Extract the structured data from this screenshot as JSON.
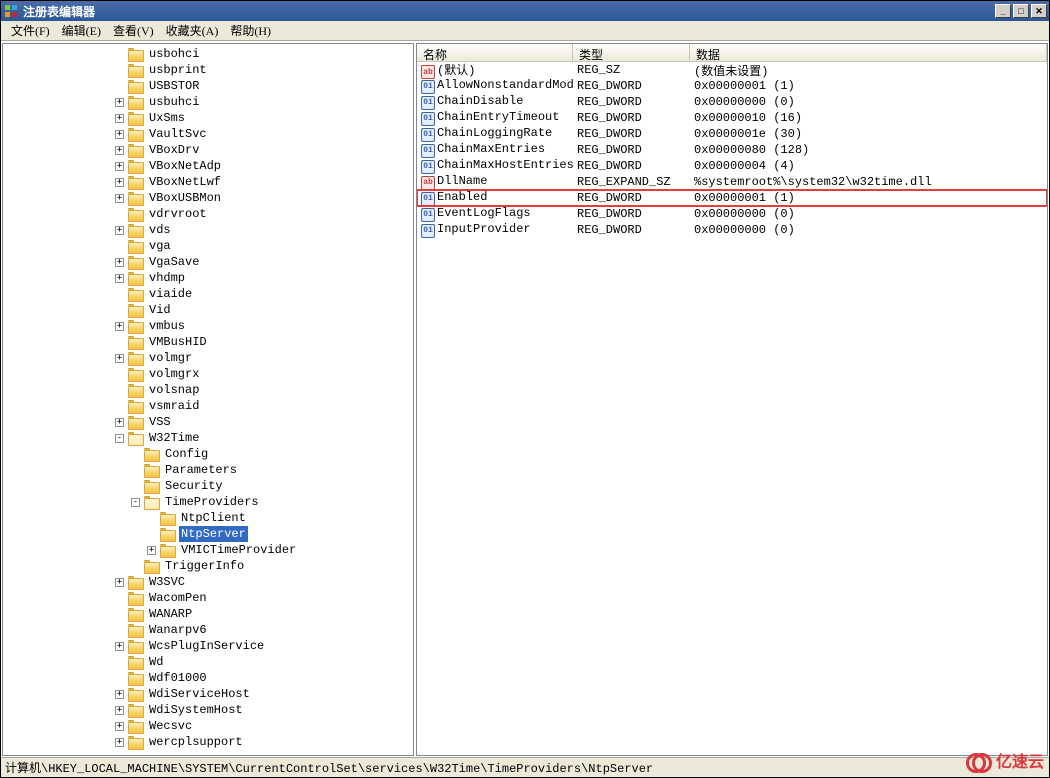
{
  "window": {
    "title": "注册表编辑器"
  },
  "menu": {
    "file": "文件(F)",
    "edit": "编辑(E)",
    "view": "查看(V)",
    "favorites": "收藏夹(A)",
    "help": "帮助(H)"
  },
  "tree": {
    "items": [
      {
        "indent": 7,
        "exp": "",
        "label": "usbohci"
      },
      {
        "indent": 7,
        "exp": "",
        "label": "usbprint"
      },
      {
        "indent": 7,
        "exp": "",
        "label": "USBSTOR"
      },
      {
        "indent": 7,
        "exp": "+",
        "label": "usbuhci"
      },
      {
        "indent": 7,
        "exp": "+",
        "label": "UxSms"
      },
      {
        "indent": 7,
        "exp": "+",
        "label": "VaultSvc"
      },
      {
        "indent": 7,
        "exp": "+",
        "label": "VBoxDrv"
      },
      {
        "indent": 7,
        "exp": "+",
        "label": "VBoxNetAdp"
      },
      {
        "indent": 7,
        "exp": "+",
        "label": "VBoxNetLwf"
      },
      {
        "indent": 7,
        "exp": "+",
        "label": "VBoxUSBMon"
      },
      {
        "indent": 7,
        "exp": "",
        "label": "vdrvroot"
      },
      {
        "indent": 7,
        "exp": "+",
        "label": "vds"
      },
      {
        "indent": 7,
        "exp": "",
        "label": "vga"
      },
      {
        "indent": 7,
        "exp": "+",
        "label": "VgaSave"
      },
      {
        "indent": 7,
        "exp": "+",
        "label": "vhdmp"
      },
      {
        "indent": 7,
        "exp": "",
        "label": "viaide"
      },
      {
        "indent": 7,
        "exp": "",
        "label": "Vid"
      },
      {
        "indent": 7,
        "exp": "+",
        "label": "vmbus"
      },
      {
        "indent": 7,
        "exp": "",
        "label": "VMBusHID"
      },
      {
        "indent": 7,
        "exp": "+",
        "label": "volmgr"
      },
      {
        "indent": 7,
        "exp": "",
        "label": "volmgrx"
      },
      {
        "indent": 7,
        "exp": "",
        "label": "volsnap"
      },
      {
        "indent": 7,
        "exp": "",
        "label": "vsmraid"
      },
      {
        "indent": 7,
        "exp": "+",
        "label": "VSS"
      },
      {
        "indent": 7,
        "exp": "-",
        "label": "W32Time",
        "open": true
      },
      {
        "indent": 8,
        "exp": "",
        "label": "Config"
      },
      {
        "indent": 8,
        "exp": "",
        "label": "Parameters"
      },
      {
        "indent": 8,
        "exp": "",
        "label": "Security"
      },
      {
        "indent": 8,
        "exp": "-",
        "label": "TimeProviders",
        "open": true
      },
      {
        "indent": 9,
        "exp": "",
        "label": "NtpClient"
      },
      {
        "indent": 9,
        "exp": "",
        "label": "NtpServer",
        "selected": true
      },
      {
        "indent": 9,
        "exp": "+",
        "label": "VMICTimeProvider"
      },
      {
        "indent": 8,
        "exp": "",
        "label": "TriggerInfo"
      },
      {
        "indent": 7,
        "exp": "+",
        "label": "W3SVC"
      },
      {
        "indent": 7,
        "exp": "",
        "label": "WacomPen"
      },
      {
        "indent": 7,
        "exp": "",
        "label": "WANARP"
      },
      {
        "indent": 7,
        "exp": "",
        "label": "Wanarpv6"
      },
      {
        "indent": 7,
        "exp": "+",
        "label": "WcsPlugInService"
      },
      {
        "indent": 7,
        "exp": "",
        "label": "Wd"
      },
      {
        "indent": 7,
        "exp": "",
        "label": "Wdf01000"
      },
      {
        "indent": 7,
        "exp": "+",
        "label": "WdiServiceHost"
      },
      {
        "indent": 7,
        "exp": "+",
        "label": "WdiSystemHost"
      },
      {
        "indent": 7,
        "exp": "+",
        "label": "Wecsvc"
      },
      {
        "indent": 7,
        "exp": "+",
        "label": "wercplsupport"
      }
    ]
  },
  "list": {
    "headers": {
      "name": "名称",
      "type": "类型",
      "data": "数据"
    },
    "rows": [
      {
        "icon": "sz",
        "name": "(默认)",
        "type": "REG_SZ",
        "data": "(数值未设置)"
      },
      {
        "icon": "dw",
        "name": "AllowNonstandardMod...",
        "type": "REG_DWORD",
        "data": "0x00000001 (1)"
      },
      {
        "icon": "dw",
        "name": "ChainDisable",
        "type": "REG_DWORD",
        "data": "0x00000000 (0)"
      },
      {
        "icon": "dw",
        "name": "ChainEntryTimeout",
        "type": "REG_DWORD",
        "data": "0x00000010 (16)"
      },
      {
        "icon": "dw",
        "name": "ChainLoggingRate",
        "type": "REG_DWORD",
        "data": "0x0000001e (30)"
      },
      {
        "icon": "dw",
        "name": "ChainMaxEntries",
        "type": "REG_DWORD",
        "data": "0x00000080 (128)"
      },
      {
        "icon": "dw",
        "name": "ChainMaxHostEntries",
        "type": "REG_DWORD",
        "data": "0x00000004 (4)"
      },
      {
        "icon": "sz",
        "name": "DllName",
        "type": "REG_EXPAND_SZ",
        "data": "%systemroot%\\system32\\w32time.dll"
      },
      {
        "icon": "dw",
        "name": "Enabled",
        "type": "REG_DWORD",
        "data": "0x00000001 (1)",
        "highlighted": true
      },
      {
        "icon": "dw",
        "name": "EventLogFlags",
        "type": "REG_DWORD",
        "data": "0x00000000 (0)"
      },
      {
        "icon": "dw",
        "name": "InputProvider",
        "type": "REG_DWORD",
        "data": "0x00000000 (0)"
      }
    ]
  },
  "statusbar": {
    "path": "计算机\\HKEY_LOCAL_MACHINE\\SYSTEM\\CurrentControlSet\\services\\W32Time\\TimeProviders\\NtpServer"
  },
  "watermark": {
    "text": "亿速云"
  },
  "icons": {
    "sz_label": "ab",
    "dw_label": "011\n110"
  }
}
